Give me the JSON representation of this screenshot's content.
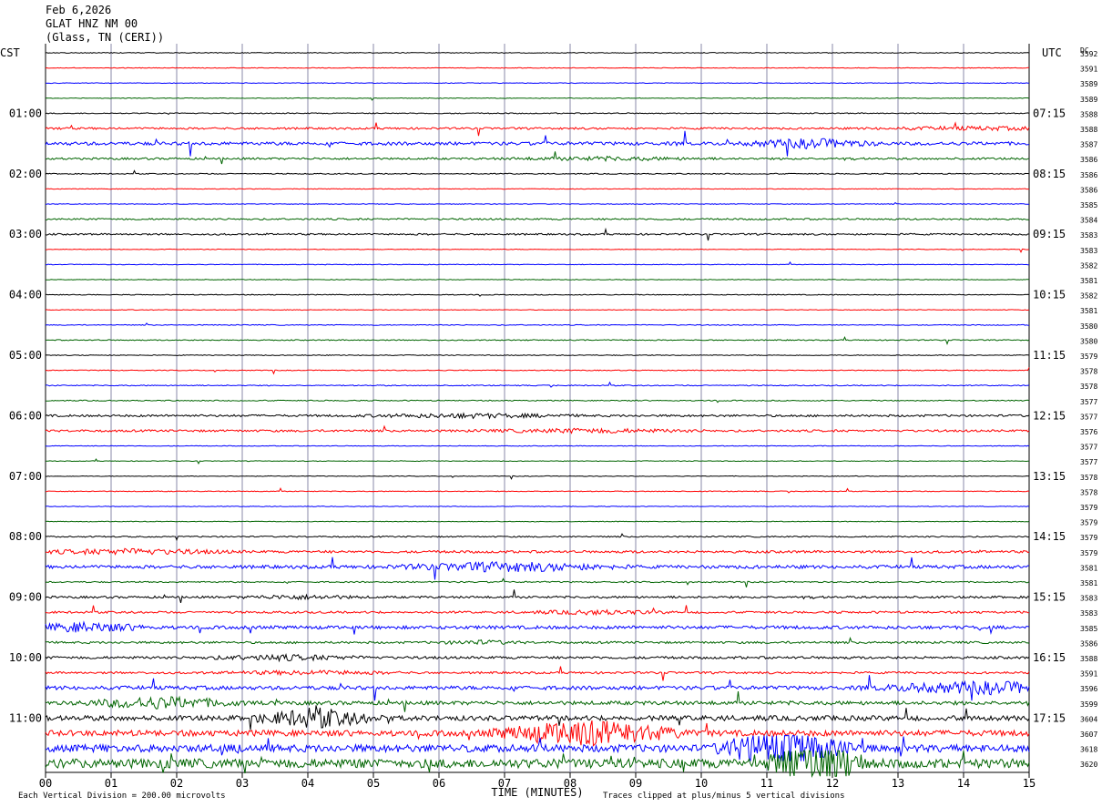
{
  "header": {
    "date": "Feb 6,2026",
    "station": "GLAT HNZ NM 00",
    "location": "(Glass, TN (CERI))"
  },
  "chart_data": {
    "type": "line",
    "left_timezone": "CST",
    "right_timezone": "UTC",
    "dc_label": "DC",
    "xlabel": "TIME (MINUTES)",
    "xlim": [
      0,
      15
    ],
    "x_ticks": [
      "00",
      "01",
      "02",
      "03",
      "04",
      "05",
      "06",
      "07",
      "08",
      "09",
      "10",
      "11",
      "12",
      "13",
      "14",
      "15"
    ],
    "left_hour_labels": [
      "01:00",
      "02:00",
      "03:00",
      "04:00",
      "05:00",
      "06:00",
      "07:00",
      "08:00",
      "09:00",
      "10:00",
      "11:00"
    ],
    "right_hour_labels": [
      "07:15",
      "08:15",
      "09:15",
      "10:15",
      "11:15",
      "12:15",
      "13:15",
      "14:15",
      "15:15",
      "16:15",
      "17:15"
    ],
    "trace_colors": [
      "#000000",
      "#ff0000",
      "#0000ff",
      "#006400"
    ],
    "trace_count": 48,
    "dc_offsets": [
      3592,
      3591,
      3589,
      3589,
      3588,
      3588,
      3587,
      3586,
      3586,
      3586,
      3585,
      3584,
      3583,
      3583,
      3582,
      3581,
      3582,
      3581,
      3580,
      3580,
      3579,
      3578,
      3578,
      3577,
      3577,
      3576,
      3577,
      3577,
      3578,
      3578,
      3579,
      3579,
      3579,
      3579,
      3581,
      3581,
      3583,
      3583,
      3585,
      3586,
      3588,
      3591,
      3596,
      3599,
      3604,
      3607,
      3618,
      3620
    ],
    "activity_levels": [
      0.5,
      0.4,
      0.4,
      0.4,
      0.6,
      1.2,
      2.0,
      1.2,
      0.6,
      0.4,
      0.4,
      1.0,
      1.0,
      0.4,
      0.4,
      0.4,
      0.5,
      0.4,
      0.5,
      0.6,
      0.5,
      0.5,
      0.6,
      0.6,
      1.3,
      1.3,
      0.4,
      0.4,
      0.4,
      0.5,
      0.4,
      0.4,
      0.8,
      1.5,
      2.0,
      0.8,
      1.3,
      1.3,
      2.0,
      1.3,
      1.5,
      1.3,
      2.3,
      2.3,
      3.0,
      3.5,
      4.5,
      5.5
    ],
    "footer_left": "Each Vertical Division =  200.00 microvolts",
    "footer_right": "Traces clipped at plus/minus 5 vertical divisions"
  }
}
